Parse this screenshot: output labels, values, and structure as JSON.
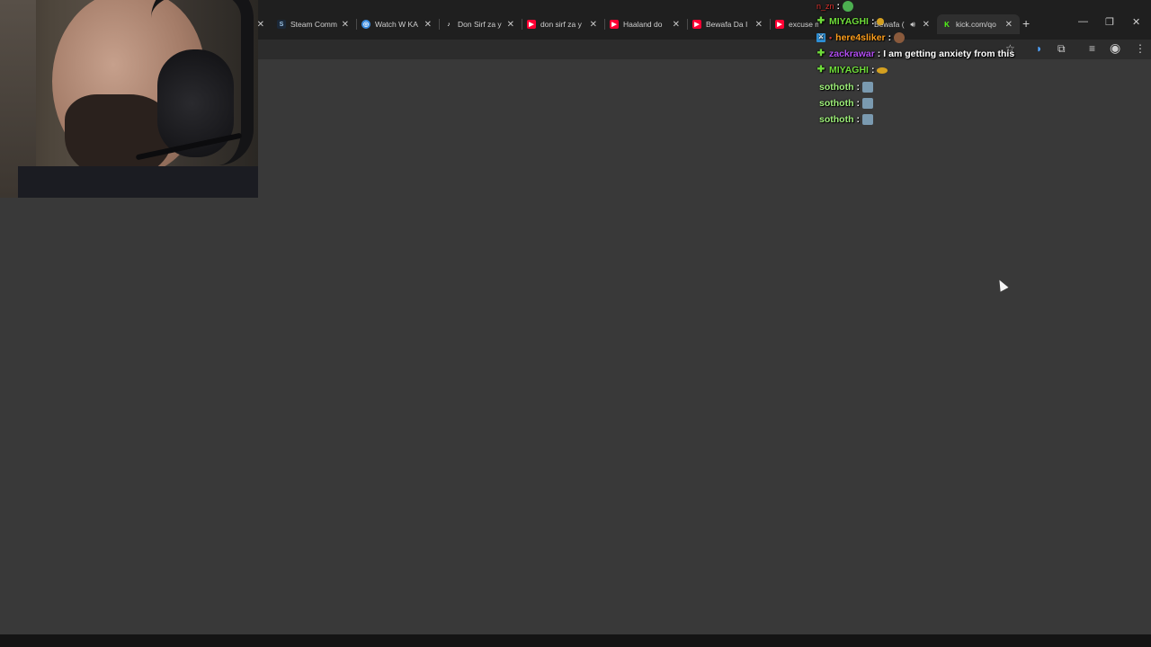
{
  "browser": {
    "tabs": [
      {
        "title": "Steam Comm",
        "favicon": "steam-icon",
        "color": "#1b2838"
      },
      {
        "title": "Watch W KA",
        "favicon": "globe-icon",
        "color": "#3b8de0"
      },
      {
        "title": "Don Sirf za y",
        "favicon": "tiktok-icon",
        "color": "#000000"
      },
      {
        "title": "don sirf za y",
        "favicon": "youtube-icon",
        "color": "#ff0033"
      },
      {
        "title": "Haaland do",
        "favicon": "youtube-icon",
        "color": "#ff0033"
      },
      {
        "title": "Bewafa Da I",
        "favicon": "youtube-icon",
        "color": "#ff0033"
      },
      {
        "title": "excuse m",
        "favicon": "youtube-icon",
        "color": "#ff0033"
      },
      {
        "title": "Bewafa (",
        "favicon": "speaker-icon",
        "color": "#ff0033"
      },
      {
        "title": "kick.com/qo",
        "favicon": "kick-icon",
        "color": "#53fc18"
      }
    ],
    "new_tab_label": "+",
    "window_controls": [
      "—",
      "❐",
      "✕"
    ]
  },
  "chat": {
    "messages": [
      {
        "user": "n_zn",
        "user_color": "#e0332e",
        "badge": "none",
        "text": "",
        "emote": "#4caf50"
      },
      {
        "user": "MIYAGHI",
        "user_color": "#6fdc3a",
        "badge": "plus",
        "text": "",
        "emote": "#d4a020"
      },
      {
        "user": "here4sliker",
        "user_color": "#ff9f1c",
        "badge": "box",
        "text": "",
        "emote": "#8a5a3c"
      },
      {
        "user": "zackrawar",
        "user_color": "#b04cf0",
        "badge": "plus",
        "text": "I am getting anxiety from this",
        "emote": ""
      },
      {
        "user": "MIYAGHI",
        "user_color": "#6fdc3a",
        "badge": "plus",
        "text": "",
        "emote": "#d4a020"
      },
      {
        "user": "sothoth",
        "user_color": "#9ef07a",
        "badge": "none",
        "text": "",
        "emote": "#7a9ab0"
      },
      {
        "user": "sothoth",
        "user_color": "#9ef07a",
        "badge": "none",
        "text": "",
        "emote": "#7a9ab0"
      },
      {
        "user": "sothoth",
        "user_color": "#9ef07a",
        "badge": "none",
        "text": "",
        "emote": "#7a9ab0"
      }
    ]
  }
}
